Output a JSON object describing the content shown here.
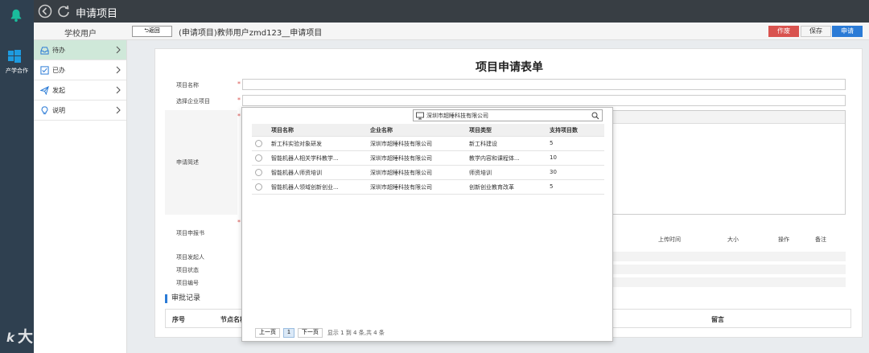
{
  "rail": {
    "apps_label": "产学合作",
    "watermark_mark": "k",
    "watermark": "大数跨境"
  },
  "titlebar": {
    "title": "申请项目"
  },
  "toolbar": {
    "user_name": "学校用户",
    "back_label": "⮌返回",
    "breadcrumb": "(申请项目)教师用户zmd123__申请项目",
    "void_label": "作废",
    "save_label": "保存",
    "apply_label": "申请"
  },
  "sidemenu": {
    "items": [
      {
        "label": "待办",
        "icon": "inbox-icon"
      },
      {
        "label": "已办",
        "icon": "check-square-icon"
      },
      {
        "label": "发起",
        "icon": "send-icon"
      },
      {
        "label": "说明",
        "icon": "lightbulb-icon"
      }
    ]
  },
  "form": {
    "title": "项目申请表单",
    "labels": {
      "project_name": "项目名称",
      "select_enterprise_project": "选择企业项目",
      "description": "申请简述",
      "report": "项目申报书",
      "initiator": "项目发起人",
      "status": "项目状态",
      "number": "项目编号"
    },
    "required_mark": "*",
    "file_columns": {
      "upload_time": "上传时间",
      "size": "大小",
      "action": "操作",
      "note": "备注"
    },
    "audit": {
      "section_title": "审批记录",
      "columns": {
        "seq": "序号",
        "node": "节点名称",
        "comment": "留言"
      }
    }
  },
  "popup": {
    "search_value": "深圳市超睡科技有限公司",
    "columns": {
      "name": "项目名称",
      "company": "企业名称",
      "type": "项目类型",
      "count": "支持项目数"
    },
    "rows": [
      {
        "name": "新工科实验对象研发",
        "company": "深圳市超睡科技有限公司",
        "type": "新工科建设",
        "count": "5"
      },
      {
        "name": "智能机器人相关学科教学...",
        "company": "深圳市超睡科技有限公司",
        "type": "教学内容和课程体...",
        "count": "10"
      },
      {
        "name": "智能机器人师资培训",
        "company": "深圳市超睡科技有限公司",
        "type": "师资培训",
        "count": "30"
      },
      {
        "name": "智能机器人领域创新创业...",
        "company": "深圳市超睡科技有限公司",
        "type": "创新创业教育改革",
        "count": "5"
      }
    ],
    "pager": {
      "prev": "上一页",
      "current": "1",
      "next": "下一页",
      "info": "显示 1 到 4 条,共 4 条"
    }
  },
  "colors": {
    "rail": "#2f4050",
    "titlebar": "#383e44",
    "active_menu": "#cfe8d9",
    "primary": "#2b7bd6",
    "danger": "#d9534f"
  }
}
